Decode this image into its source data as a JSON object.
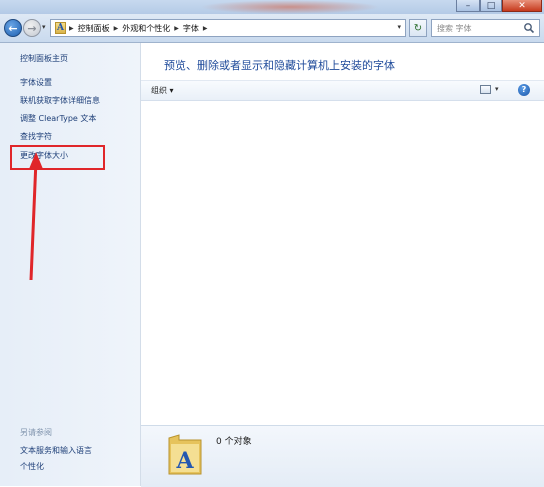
{
  "window": {
    "minimize_glyph": "–",
    "maximize_glyph": "□",
    "close_glyph": "✕"
  },
  "address_bar": {
    "breadcrumbs": [
      "控制面板",
      "外观和个性化",
      "字体"
    ]
  },
  "search": {
    "placeholder": "搜索 字体"
  },
  "left_panel": {
    "home_link": "控制面板主页",
    "links": [
      "字体设置",
      "联机获取字体详细信息",
      "调整 ClearType 文本",
      "查找字符",
      "更改字体大小"
    ],
    "see_also_heading": "另请参阅",
    "see_also_links": [
      "文本服务和输入语言",
      "个性化"
    ]
  },
  "main": {
    "title": "预览、删除或者显示和隐藏计算机上安装的字体",
    "toolbar": {
      "organize_label": "组织",
      "help_glyph": "?"
    }
  },
  "details": {
    "object_count": "0 个对象"
  },
  "annotation": {
    "color": "#e0262a"
  },
  "colors": {
    "link": "#1e3f78",
    "title": "#1e4a9a",
    "accent": "#1d5fb0"
  }
}
